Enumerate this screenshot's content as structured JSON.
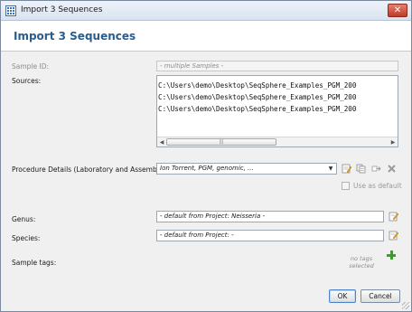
{
  "window": {
    "title": "Import 3 Sequences"
  },
  "header": {
    "title": "Import 3 Sequences"
  },
  "sample_id": {
    "label": "Sample ID:",
    "value": "- multiple Samples -"
  },
  "sources": {
    "label": "Sources:",
    "items": [
      "C:\\Users\\demo\\Desktop\\SeqSphere_Examples_PGM_200",
      "C:\\Users\\demo\\Desktop\\SeqSphere_Examples_PGM_200",
      "C:\\Users\\demo\\Desktop\\SeqSphere_Examples_PGM_200"
    ],
    "scroll_left": "◀",
    "scroll_thumb": "|||",
    "scroll_right": "▶"
  },
  "procedure": {
    "label": "Procedure Details (Laboratory and Assembly):",
    "value": "Ion Torrent, PGM, genomic, ...",
    "arrow": "▼"
  },
  "use_as_default": {
    "label": "Use as default",
    "checked": false
  },
  "genus": {
    "label": "Genus:",
    "value": "- default from Project: Neisseria -"
  },
  "species": {
    "label": "Species:",
    "value": "- default from Project: -"
  },
  "sample_tags": {
    "label": "Sample tags:",
    "empty_text": "no tags selected"
  },
  "buttons": {
    "ok": "OK",
    "cancel": "Cancel",
    "close": "✕"
  },
  "colors": {
    "header_title": "#2a5d8c",
    "plus": "#3f9a2f",
    "close": "#c03a25"
  }
}
